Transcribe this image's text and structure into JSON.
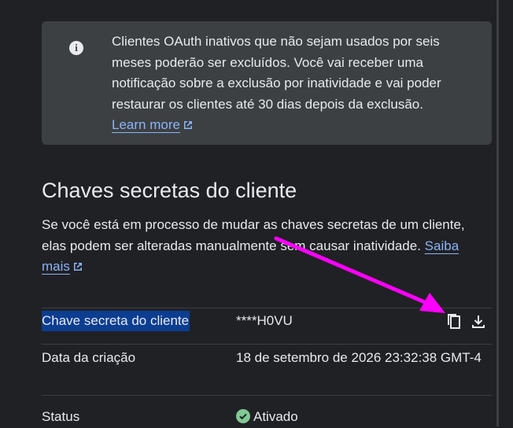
{
  "info_notice": {
    "icon": "info-icon",
    "text": "Clientes OAuth inativos que não sejam usados por seis meses poderão ser excluídos. Você vai receber uma notificação sobre a exclusão por inatividade e vai poder restaurar os clientes até 30 dias depois da exclusão.",
    "link_label": "Learn more"
  },
  "secrets_section": {
    "title": "Chaves secretas do cliente",
    "description": "Se você está em processo de mudar as chaves secretas de um cliente, elas podem ser alteradas manualmente sem causar inatividade.",
    "link_label": "Saiba mais"
  },
  "secret_table": {
    "rows": [
      {
        "label": "Chave secreta do cliente",
        "value": "****H0VU"
      },
      {
        "label": "Data da criação",
        "value": "18 de setembro de 2026 23:32:38 GMT-4"
      },
      {
        "label": "Status",
        "value": "Ativado"
      }
    ],
    "actions": [
      "copy-icon",
      "download-icon"
    ]
  },
  "colors": {
    "background": "#202124",
    "panel": "#3c4043",
    "link": "#8ab4f8",
    "selection": "#0b3d91",
    "annotation_arrow": "#ff00ff",
    "status_ok": "#81c995"
  }
}
